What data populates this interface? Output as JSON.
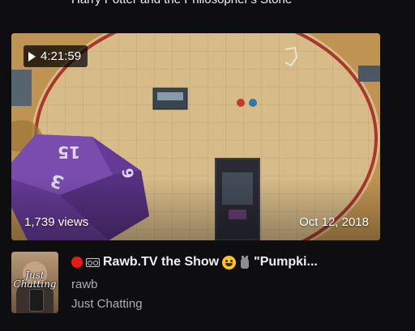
{
  "previous_card": {
    "title": "Harry Potter and the Philosopher's Stone"
  },
  "video": {
    "duration": "4:21:59",
    "views": "1,739 views",
    "date": "Oct 12, 2018",
    "title": "Rawb.TV the Show",
    "title_suffix": "\"Pumpki...",
    "channel": "rawb",
    "category": "Just Chatting",
    "avatar_text": "Just Chatting"
  },
  "colors": {
    "background": "#0e0e10",
    "text_primary": "#efeff1",
    "text_secondary": "#adadb8",
    "live_dot": "#e91916"
  },
  "icons": {
    "duration": "play-icon",
    "title_emotes": [
      "red-circle-icon",
      "tape-icon",
      "smile-emoji-icon",
      "cat-emoji-icon"
    ]
  }
}
